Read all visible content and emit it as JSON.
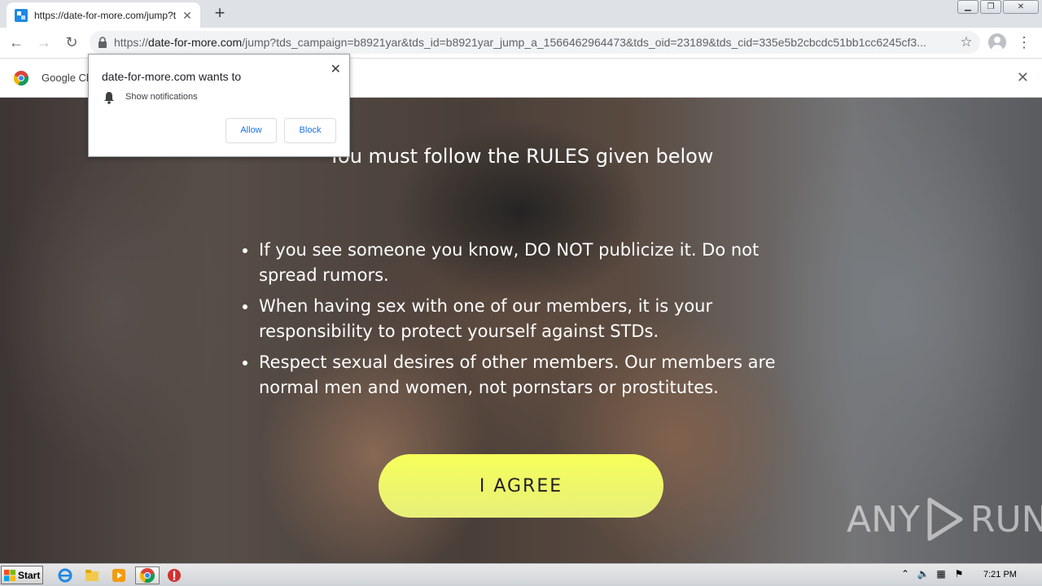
{
  "browser": {
    "tab": {
      "title": "https://date-for-more.com/jump?tds",
      "favicon": "site-favicon-icon"
    },
    "new_tab_label": "+",
    "omnibox": {
      "url_prefix": "https://",
      "url_host": "date-for-more.com",
      "url_rest": "/jump?tds_campaign=b8921yar&tds_id=b8921yar_jump_a_1566462964473&tds_oid=23189&tds_cid=335e5b2cbcdc51bb1cc6245cf3..."
    },
    "infobar": {
      "text": "Google Ch"
    }
  },
  "popup": {
    "title": "date-for-more.com wants to",
    "permission": "Show notifications",
    "allow_label": "Allow",
    "block_label": "Block"
  },
  "page": {
    "heading": "You must follow the RULES given below",
    "rules": [
      "If you see someone you know, DO NOT publicize it. Do not spread rumors.",
      "When having sex with one of our members, it is your responsibility to protect yourself against STDs.",
      "Respect sexual desires of other members. Our members are normal men and women, not pornstars or prostitutes."
    ],
    "agree_label": "I AGREE",
    "watermark": {
      "left": "ANY",
      "right": "RUN"
    }
  },
  "taskbar": {
    "start_label": "Start",
    "clock": "7:21 PM"
  },
  "colors": {
    "agree_button": "#f3fb5e",
    "link_blue": "#1a73e8",
    "chrome_tabstrip": "#dee1e6"
  }
}
